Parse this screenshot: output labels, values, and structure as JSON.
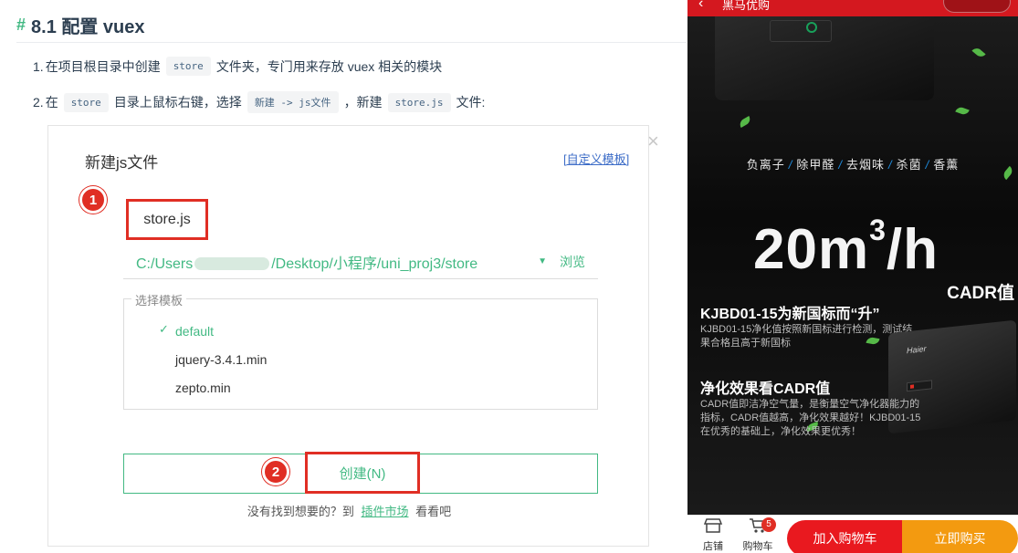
{
  "doc": {
    "hash": "#",
    "heading": "8.1 配置 vuex",
    "steps": [
      {
        "num": "1.",
        "pre": "在项目根目录中创建",
        "code1": "store",
        "post": "文件夹，专门用来存放 vuex 相关的模块"
      },
      {
        "num": "2.",
        "pre": "在",
        "code1": "store",
        "mid1": "目录上鼠标右键，选择",
        "code2": "新建 -> js文件",
        "mid2": "，新建",
        "code3": "store.js",
        "post": "文件:"
      }
    ]
  },
  "dialog": {
    "title": "新建js文件",
    "custom_template_link": "自定义模板",
    "close_icon": "×",
    "step1_badge": "1",
    "step2_badge": "2",
    "filename": "store.js",
    "path_prefix": "C:/Users",
    "path_suffix": "/Desktop/小程序/uni_proj3/store",
    "dropdown_caret": "▼",
    "browse": "浏览",
    "template_legend": "选择模板",
    "templates": [
      {
        "name": "default",
        "selected": true
      },
      {
        "name": "jquery-3.4.1.min",
        "selected": false
      },
      {
        "name": "zepto.min",
        "selected": false
      }
    ],
    "check_icon": "✓",
    "create_button": "创建(N)",
    "hint_pre": "没有找到想要的？到",
    "hint_link": "插件市场",
    "hint_post": "看看吧"
  },
  "phone": {
    "topbar": {
      "back_icon": "‹",
      "title": "黑马优购"
    },
    "features": [
      "负离子",
      "除甲醛",
      "去烟味",
      "杀菌",
      "香薰"
    ],
    "feature_sep": "/",
    "big_number": "20m",
    "big_sup": "3",
    "big_unit": "/h",
    "cadr_label": "CADR值",
    "heading1": "KJBD01-15为新国标而“升”",
    "para1": "KJBD01-15净化值按照新国标进行检测，测试结果合格且高于新国标",
    "heading2": "净化效果看CADR值",
    "para2": "CADR值即洁净空气量，是衡量空气净化器能力的指标，CADR值越高，净化效果越好！KJBD01-15在优秀的基础上，净化效果更优秀！",
    "device_brand": "Haier",
    "bottom": {
      "shop_label": "店铺",
      "cart_label": "购物车",
      "cart_count": "5",
      "add_to_cart": "加入购物车",
      "buy_now": "立即购买"
    }
  },
  "colors": {
    "accent_green": "#42b983",
    "highlight_red": "#e02e24",
    "cart_red": "#e9191f",
    "buy_orange": "#f39a10"
  }
}
